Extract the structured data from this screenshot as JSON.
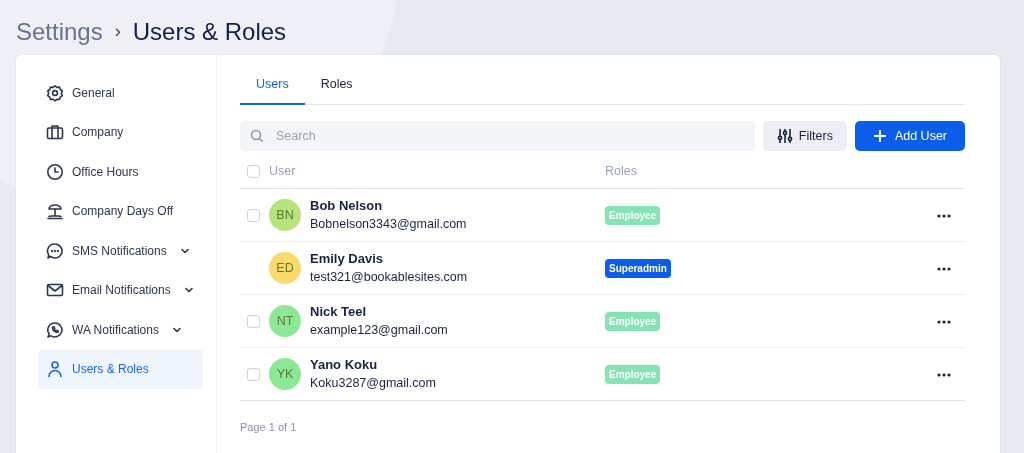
{
  "breadcrumb": {
    "parent": "Settings",
    "separator": "›",
    "current": "Users & Roles"
  },
  "sidebar": {
    "items": [
      {
        "label": "General",
        "kind": "gear",
        "expandable": false,
        "selected": false
      },
      {
        "label": "Company",
        "kind": "briefcase",
        "expandable": false,
        "selected": false
      },
      {
        "label": "Office Hours",
        "kind": "clock",
        "expandable": false,
        "selected": false
      },
      {
        "label": "Company Days Off",
        "kind": "umbrella",
        "expandable": false,
        "selected": false
      },
      {
        "label": "SMS Notifications",
        "kind": "chat",
        "expandable": true,
        "selected": false
      },
      {
        "label": "Email Notifications",
        "kind": "mail",
        "expandable": true,
        "selected": false
      },
      {
        "label": "WA Notifications",
        "kind": "whatsapp",
        "expandable": true,
        "selected": false
      },
      {
        "label": "Users & Roles",
        "kind": "person",
        "expandable": false,
        "selected": true
      }
    ]
  },
  "tabs": [
    {
      "label": "Users",
      "selected": true
    },
    {
      "label": "Roles",
      "selected": false
    }
  ],
  "search": {
    "placeholder": "Search"
  },
  "buttons": {
    "filters": "Filters",
    "add": "Add User"
  },
  "table": {
    "columns": [
      "User",
      "Roles"
    ],
    "header_checked": false,
    "rows": [
      {
        "initials": "BN",
        "color": "#b6e37a",
        "name": "Bob Nelson",
        "email": "Bobnelson3343@gmail.com",
        "role": {
          "label": "Employee",
          "color": "#86e3b4"
        },
        "selectable": true,
        "checked": false
      },
      {
        "initials": "ED",
        "color": "#fbd96a",
        "name": "Emily Davis",
        "email": "test321@bookablesites.com",
        "role": {
          "label": "Superadmin",
          "color": "#0b5ee8"
        },
        "selectable": false
      },
      {
        "initials": "NT",
        "color": "#8de896",
        "name": "Nick Teel",
        "email": "example123@gmail.com",
        "role": {
          "label": "Employee",
          "color": "#86e3b4"
        },
        "selectable": true,
        "checked": false
      },
      {
        "initials": "YK",
        "color": "#8de896",
        "name": "Yano Koku",
        "email": "Koku3287@gmail.com",
        "role": {
          "label": "Employee",
          "color": "#86e3b4"
        },
        "selectable": true,
        "checked": false
      }
    ]
  },
  "pagination": "Page 1 of 1"
}
